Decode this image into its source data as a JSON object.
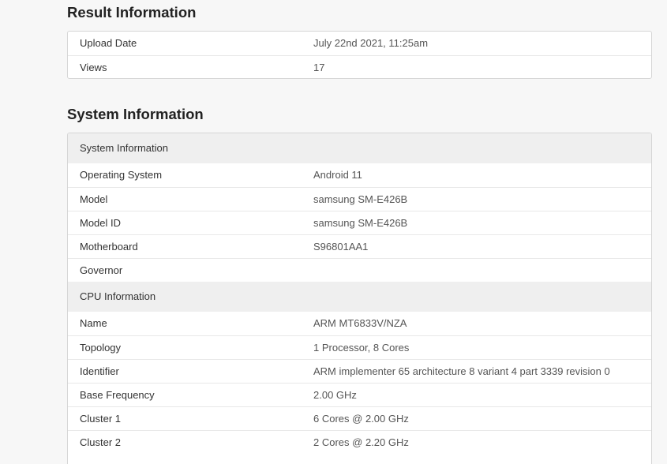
{
  "result": {
    "title": "Result Information",
    "rows": [
      {
        "label": "Upload Date",
        "value": "July 22nd 2021, 11:25am"
      },
      {
        "label": "Views",
        "value": "17"
      }
    ]
  },
  "system": {
    "title": "System Information",
    "system_group": {
      "heading": "System Information",
      "rows": [
        {
          "label": "Operating System",
          "value": "Android 11"
        },
        {
          "label": "Model",
          "value": "samsung SM-E426B"
        },
        {
          "label": "Model ID",
          "value": "samsung SM-E426B"
        },
        {
          "label": "Motherboard",
          "value": "S96801AA1"
        },
        {
          "label": "Governor",
          "value": ""
        }
      ]
    },
    "cpu_group": {
      "heading": "CPU Information",
      "rows": [
        {
          "label": "Name",
          "value": "ARM MT6833V/NZA"
        },
        {
          "label": "Topology",
          "value": "1 Processor, 8 Cores"
        },
        {
          "label": "Identifier",
          "value": "ARM implementer 65 architecture 8 variant 4 part 3339 revision 0"
        },
        {
          "label": "Base Frequency",
          "value": "2.00 GHz"
        },
        {
          "label": "Cluster 1",
          "value": "6 Cores @ 2.00 GHz"
        },
        {
          "label": "Cluster 2",
          "value": "2 Cores @ 2.20 GHz"
        }
      ]
    }
  }
}
